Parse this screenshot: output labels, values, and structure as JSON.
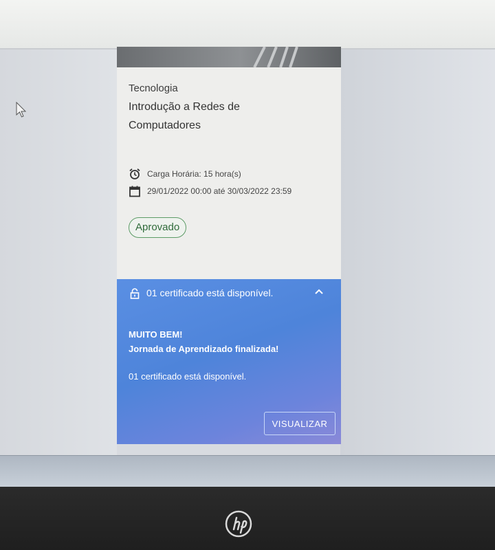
{
  "course": {
    "category": "Tecnologia",
    "title": "Introdução a Redes de Computadores",
    "workload": "Carga Horária: 15 hora(s)",
    "period": "29/01/2022 00:00 até 30/03/2022 23:59",
    "status": "Aprovado"
  },
  "certificate_panel": {
    "header": "01 certificado está disponível.",
    "congrats_line1": "MUITO BEM!",
    "congrats_line2": "Jornada de Aprendizado finalizada!",
    "available_text": "01 certificado está disponível.",
    "view_button": "VISUALIZAR"
  },
  "icons": {
    "workload": "alarm-clock-icon",
    "period": "calendar-icon",
    "panel_lock": "lock-icon",
    "panel_toggle": "chevron-up-icon"
  },
  "colors": {
    "panel_blue": "#5a8fe3",
    "approved_green": "#2f6b3a"
  }
}
